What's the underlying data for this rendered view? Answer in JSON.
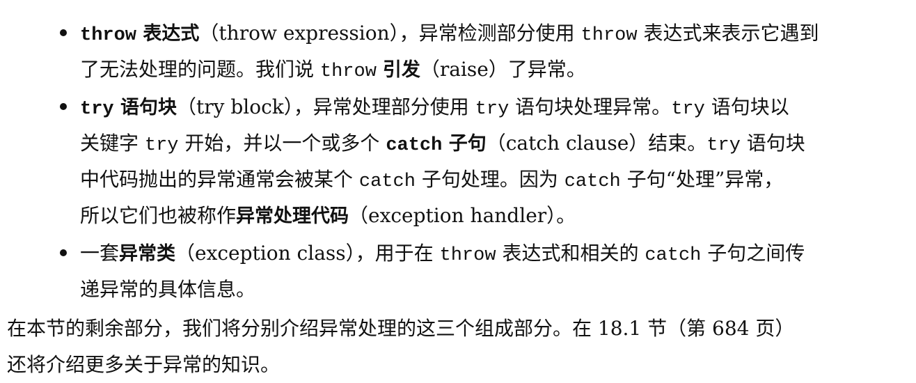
{
  "items": [
    {
      "lines": [
        [
          {
            "t": "throw",
            "s": "codeb"
          },
          {
            "t": " 表达式",
            "s": "b"
          },
          {
            "t": "（throw expression），异常检测部分使用 ",
            "s": ""
          },
          {
            "t": "throw",
            "s": "code"
          },
          {
            "t": " 表达式来表示它遇到",
            "s": ""
          }
        ],
        [
          {
            "t": "了无法处理的问题。我们说 ",
            "s": ""
          },
          {
            "t": "throw",
            "s": "code"
          },
          {
            "t": " ",
            "s": ""
          },
          {
            "t": "引发",
            "s": "b"
          },
          {
            "t": "（raise）了异常。",
            "s": ""
          }
        ]
      ]
    },
    {
      "lines": [
        [
          {
            "t": "try",
            "s": "codeb"
          },
          {
            "t": " 语句块",
            "s": "b"
          },
          {
            "t": "（try block），异常处理部分使用 ",
            "s": ""
          },
          {
            "t": "try",
            "s": "code"
          },
          {
            "t": " 语句块处理异常。",
            "s": ""
          },
          {
            "t": "try",
            "s": "code"
          },
          {
            "t": " 语句块以",
            "s": ""
          }
        ],
        [
          {
            "t": "关键字 ",
            "s": ""
          },
          {
            "t": "try",
            "s": "code"
          },
          {
            "t": " 开始，并以一个或多个 ",
            "s": ""
          },
          {
            "t": "catch",
            "s": "codeb"
          },
          {
            "t": " 子句",
            "s": "b"
          },
          {
            "t": "（catch clause）结束。",
            "s": ""
          },
          {
            "t": "try",
            "s": "code"
          },
          {
            "t": " 语句块",
            "s": ""
          }
        ],
        [
          {
            "t": "中代码抛出的异常通常会被某个 ",
            "s": ""
          },
          {
            "t": "catch",
            "s": "code"
          },
          {
            "t": " 子句处理。因为 ",
            "s": ""
          },
          {
            "t": "catch",
            "s": "code"
          },
          {
            "t": " 子句“处理”异常，",
            "s": ""
          }
        ],
        [
          {
            "t": "所以它们也被称作",
            "s": ""
          },
          {
            "t": "异常处理代码",
            "s": "b"
          },
          {
            "t": "（exception handler）。",
            "s": ""
          }
        ]
      ]
    },
    {
      "lines": [
        [
          {
            "t": "一套",
            "s": ""
          },
          {
            "t": "异常类",
            "s": "b"
          },
          {
            "t": "（exception class），用于在 ",
            "s": ""
          },
          {
            "t": "throw",
            "s": "code"
          },
          {
            "t": " 表达式和相关的 ",
            "s": ""
          },
          {
            "t": "catch",
            "s": "code"
          },
          {
            "t": " 子句之间传",
            "s": ""
          }
        ],
        [
          {
            "t": "递异常的具体信息。",
            "s": ""
          }
        ]
      ]
    }
  ],
  "paragraph": {
    "lines": [
      [
        {
          "t": "在本节的剩余部分，我们将分别介绍异常处理的这三个组成部分。在 18.1 节（第 684 页）",
          "s": ""
        }
      ],
      [
        {
          "t": "还将介绍更多关于异常的知识。",
          "s": ""
        }
      ]
    ]
  }
}
